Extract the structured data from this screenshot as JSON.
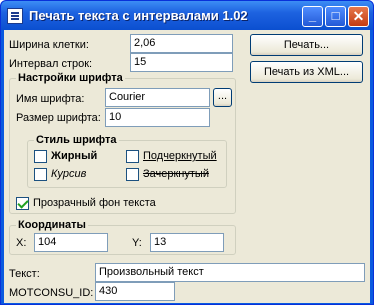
{
  "window": {
    "title": "Печать текста с интервалами 1.02",
    "minimize_glyph": "_",
    "maximize_glyph": "□",
    "close_glyph": "✕"
  },
  "cell_width": {
    "label": "Ширина клетки:",
    "value": "2,06"
  },
  "line_interval": {
    "label": "Интервал строк:",
    "value": "15"
  },
  "buttons": {
    "print": "Печать...",
    "print_xml": "Печать из XML..."
  },
  "font_settings": {
    "title": "Настройки шрифта",
    "font_name_label": "Имя шрифта:",
    "font_name_value": "Courier",
    "browse_label": "...",
    "font_size_label": "Размер шрифта:",
    "font_size_value": "10"
  },
  "font_style": {
    "title": "Стиль шрифта",
    "bold": "Жирный",
    "italic": "Курсив",
    "underline": "Подчеркнутый",
    "strikeout": "Зачеркнутый"
  },
  "transparent_bg": {
    "label": "Прозрачный фон текста",
    "checked": true
  },
  "coordinates": {
    "title": "Координаты",
    "x_label": "X:",
    "x_value": "104",
    "y_label": "Y:",
    "y_value": "13"
  },
  "text": {
    "label": "Текст:",
    "value": "Произвольный текст"
  },
  "motconsu": {
    "label": "MOTCONSU_ID:",
    "value": "430"
  }
}
